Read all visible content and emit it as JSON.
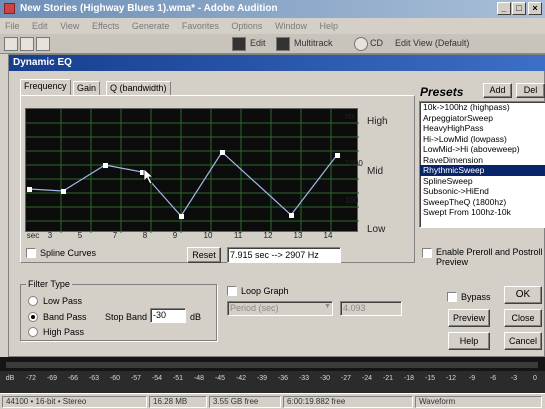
{
  "app": {
    "title": "New Stories (Highway Blues 1).wma* - Adobe Audition",
    "minimize_glyph": "_",
    "maximize_glyph": "□",
    "close_glyph": "×",
    "menu": [
      "File",
      "Edit",
      "View",
      "Effects",
      "Generate",
      "Favorites",
      "Options",
      "Window",
      "Help"
    ],
    "toolbar": {
      "edit_label": "Edit",
      "multitrack_label": "Multitrack",
      "cd_label": "CD",
      "workspace_label": "Edit View (Default)"
    }
  },
  "dialog": {
    "title": "Dynamic EQ",
    "tabs": [
      "Frequency",
      "Gain",
      "Q (bandwidth)"
    ],
    "graph": {
      "right_labels": [
        "High",
        "Mid",
        "Low"
      ],
      "hz_labels": [
        "Hz",
        "1000",
        "100"
      ],
      "x_ticks": [
        "sec",
        "3",
        "5",
        "7",
        "8",
        "9",
        "10",
        "11",
        "12",
        "13",
        "14"
      ]
    },
    "spline_label": "Spline Curves",
    "reset_label": "Reset",
    "readout": "7.915 sec --> 2907 Hz",
    "filter_type": {
      "group_label": "Filter Type",
      "options": [
        "Low Pass",
        "Band Pass",
        "High Pass"
      ],
      "selected": "Band Pass",
      "stop_band_label": "Stop Band",
      "stop_band_value": "-30",
      "stop_band_unit": "dB"
    },
    "loop_graph": {
      "label": "Loop Graph",
      "period_placeholder": "Period (sec)",
      "period_value": "4.093"
    },
    "presets": {
      "title": "Presets",
      "add_label": "Add",
      "del_label": "Del",
      "items": [
        "10k->100hz (highpass)",
        "ArpeggiatorSweep",
        "HeavyHighPass",
        "Hi->LowMid (lowpass)",
        "LowMid->Hi (aboveweep)",
        "RaveDimension",
        "RhythmicSweep",
        "SplineSweep",
        "Subsonic->HiEnd",
        "SweepTheQ (1800hz)",
        "Swept From 100hz-10k"
      ],
      "selected": "RhythmicSweep"
    },
    "preroll_label": "Enable Preroll and Postroll Preview",
    "bypass_label": "Bypass",
    "buttons": {
      "ok": "OK",
      "preview": "Preview",
      "close": "Close",
      "help": "Help",
      "cancel": "Cancel"
    }
  },
  "ruler_ticks": [
    "dB",
    "-72",
    "-69",
    "-66",
    "-63",
    "-60",
    "-57",
    "-54",
    "-51",
    "-48",
    "-45",
    "-42",
    "-39",
    "-36",
    "-33",
    "-30",
    "-27",
    "-24",
    "-21",
    "-18",
    "-15",
    "-12",
    "-9",
    "-6",
    "-3",
    "0"
  ],
  "status": {
    "cells": [
      "44100 • 16-bit • Stereo",
      "16.28 MB",
      "3.55 GB free",
      "6:00:19.882 free",
      "Waveform"
    ]
  },
  "colors": {
    "dialog_title": "#163e8e",
    "curve": "#9fb8ea",
    "selection": "#0a246a"
  }
}
